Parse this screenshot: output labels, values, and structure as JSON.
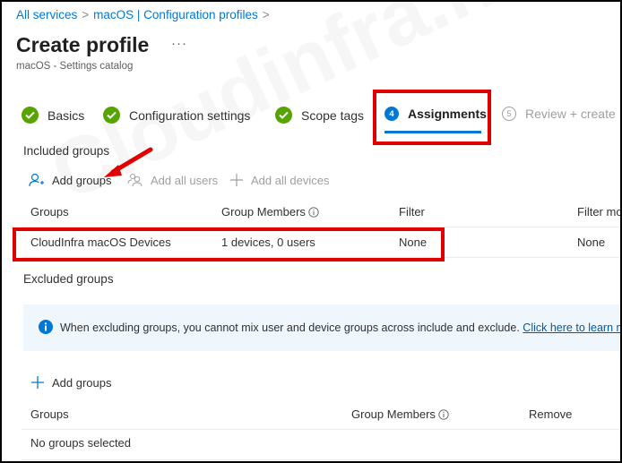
{
  "breadcrumb": {
    "items": [
      "All services",
      "macOS | Configuration profiles"
    ],
    "separator": ">"
  },
  "header": {
    "title": "Create profile",
    "more_label": "···",
    "subtitle": "macOS - Settings catalog"
  },
  "wizard": {
    "steps": [
      {
        "label": "Basics",
        "status": "complete"
      },
      {
        "label": "Configuration settings",
        "status": "complete"
      },
      {
        "label": "Scope tags",
        "status": "complete"
      },
      {
        "label": "Assignments",
        "number": "4",
        "status": "active"
      },
      {
        "label": "Review + create",
        "number": "5",
        "status": "disabled"
      }
    ]
  },
  "included": {
    "label": "Included groups",
    "commands": [
      {
        "label": "Add groups",
        "icon": "add-person-icon",
        "enabled": true
      },
      {
        "label": "Add all users",
        "icon": "people-icon",
        "enabled": false
      },
      {
        "label": "Add all devices",
        "icon": "plus-icon",
        "enabled": false
      }
    ],
    "columns": [
      "Groups",
      "Group Members",
      "Filter",
      "Filter mo"
    ],
    "rows": [
      {
        "group": "CloudInfra macOS Devices",
        "members": "1 devices, 0 users",
        "filter": "None",
        "filter_mode": "None"
      }
    ]
  },
  "excluded": {
    "label": "Excluded groups",
    "info": {
      "icon": "info-icon",
      "text": "When excluding groups, you cannot mix user and device groups across include and exclude.",
      "link": "Click here to learn more a"
    },
    "add_label": "Add groups",
    "columns": [
      "Groups",
      "Group Members",
      "Remove"
    ],
    "empty_text": "No groups selected"
  },
  "watermark": "Cloudinfra.net",
  "colors": {
    "accent": "#0078d4",
    "success": "#57a300",
    "annotation": "#e00000",
    "info_bg": "#eff6fc"
  }
}
